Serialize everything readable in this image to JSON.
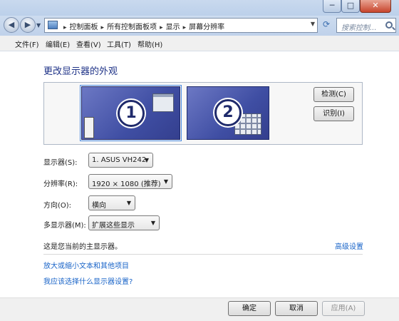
{
  "window": {
    "minimize_glyph": "─",
    "maximize_glyph": "□",
    "close_glyph": "✕"
  },
  "nav": {
    "back_glyph": "◀",
    "forward_glyph": "▶",
    "dropdown_glyph": "▼",
    "refresh_glyph": "⟳",
    "breadcrumbs": [
      "控制面板",
      "所有控制面板项",
      "显示",
      "屏幕分辨率"
    ],
    "separator": "▸",
    "search_placeholder": "搜索控制..."
  },
  "menu": [
    "文件(F)",
    "编辑(E)",
    "查看(V)",
    "工具(T)",
    "帮助(H)"
  ],
  "main": {
    "title": "更改显示器的外观",
    "monitors": [
      {
        "number": "1",
        "selected": true
      },
      {
        "number": "2",
        "selected": false
      }
    ],
    "detect_button": "检测(C)",
    "identify_button": "识别(I)",
    "fields": {
      "display": {
        "label": "显示器(S):",
        "value": "1. ASUS VH242"
      },
      "resolution": {
        "label": "分辨率(R):",
        "value": "1920 × 1080 (推荐)"
      },
      "orientation": {
        "label": "方向(O):",
        "value": "横向"
      },
      "multiple": {
        "label": "多显示器(M):",
        "value": "扩展这些显示"
      }
    },
    "dropdown_glyph": "▼",
    "main_display_info": "这是您当前的主显示器。",
    "advanced_link": "高级设置",
    "text_size_link": "放大或缩小文本和其他项目",
    "which_settings_link": "我应该选择什么显示器设置?"
  },
  "footer": {
    "ok_button": "确定",
    "cancel_button": "取消",
    "apply_button": "应用(A)"
  },
  "colors": {
    "accent_link": "#1964c8",
    "title_blue": "#1e3287",
    "monitor_fill": "#3f4ea3"
  }
}
